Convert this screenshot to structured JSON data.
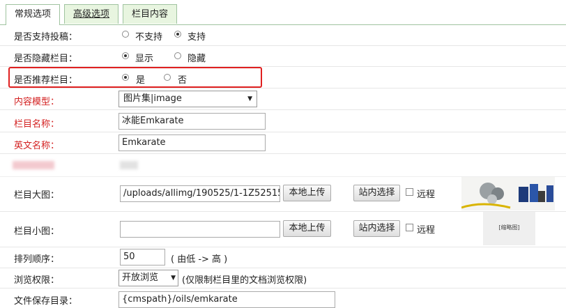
{
  "tabs": [
    {
      "label": "常规选项"
    },
    {
      "label": "高级选项"
    },
    {
      "label": "栏目内容"
    }
  ],
  "form": {
    "submission": {
      "label": "是否支持投稿：",
      "options": [
        "不支持",
        "支持"
      ],
      "selected": "支持"
    },
    "hide": {
      "label": "是否隐藏栏目：",
      "options": [
        "显示",
        "隐藏"
      ],
      "selected": "显示"
    },
    "recommend": {
      "label": "是否推荐栏目：",
      "options": [
        "是",
        "否"
      ],
      "selected": "是"
    },
    "model": {
      "label": "内容模型：",
      "value": "图片集|image"
    },
    "name": {
      "label": "栏目名称：",
      "value": "冰能Emkarate"
    },
    "en_name": {
      "label": "英文名称：",
      "value": "Emkarate"
    },
    "big_image": {
      "label": "栏目大图：",
      "value": "/uploads/allimg/190525/1-1Z52515",
      "upload": "本地上传",
      "pick": "站内选择",
      "remote": "远程"
    },
    "small_image": {
      "label": "栏目小图：",
      "value": "",
      "upload": "本地上传",
      "pick": "站内选择",
      "remote": "远程",
      "thumb_text": "[缩略图]"
    },
    "order": {
      "label": "排列顺序：",
      "value": "50",
      "hint": "( 由低 -> 高 )"
    },
    "access": {
      "label": "浏览权限：",
      "value": "开放浏览",
      "hint": "(仅限制栏目里的文档浏览权限)"
    },
    "save_dir": {
      "label": "文件保存目录：",
      "value": "{cmspath}/oils/emkarate"
    }
  },
  "colors": {
    "required_label": "#d32020",
    "highlight_border": "#e02020",
    "tab_bg": "#e8f5e0"
  }
}
